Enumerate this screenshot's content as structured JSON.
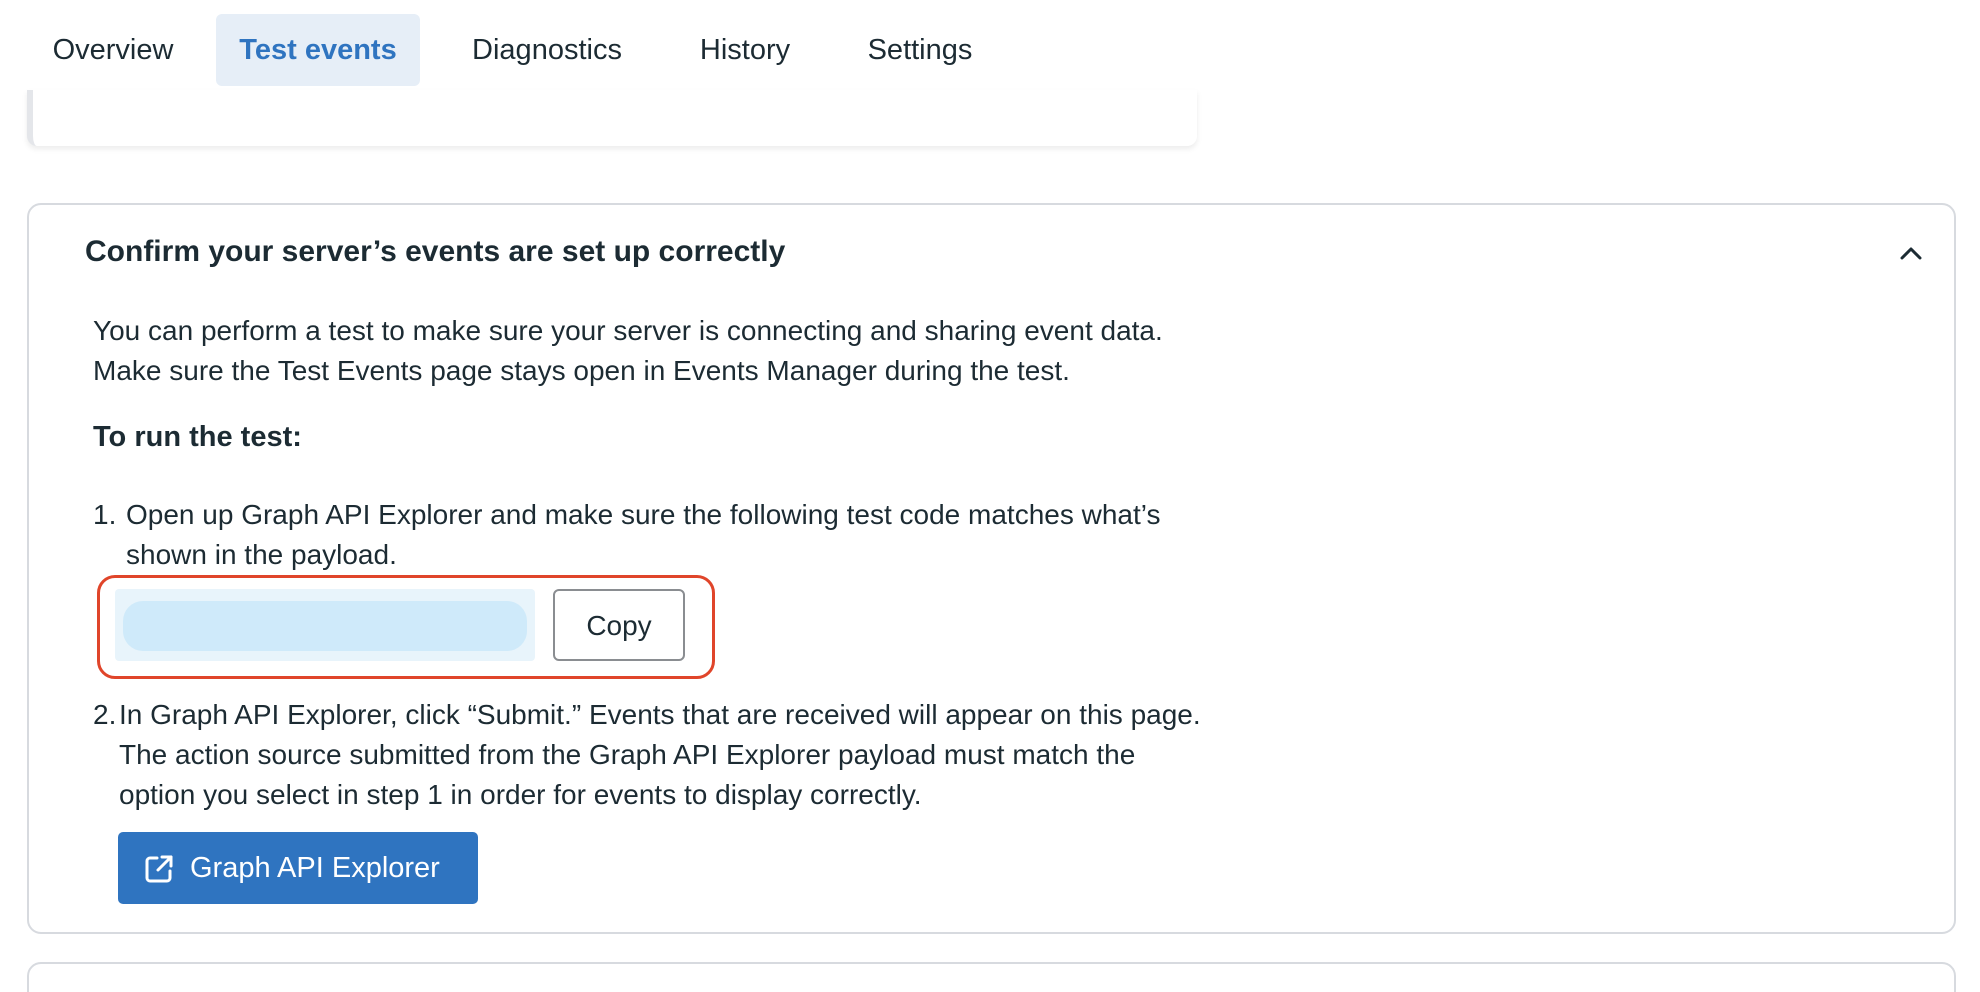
{
  "tabs": [
    {
      "label": "Overview",
      "active": false
    },
    {
      "label": "Test events",
      "active": true
    },
    {
      "label": "Diagnostics",
      "active": false
    },
    {
      "label": "History",
      "active": false
    },
    {
      "label": "Settings",
      "active": false
    }
  ],
  "card": {
    "title": "Confirm your server’s events are set up correctly",
    "description": [
      "You can perform a test to make sure your server is connecting and sharing event data.",
      "Make sure the Test Events page stays open in Events Manager during the test."
    ],
    "run_title": "To run the test:",
    "step1": {
      "number": "1.",
      "lines": [
        "Open up Graph API Explorer and make sure the following test code matches what’s",
        "shown in the payload."
      ],
      "test_code": "",
      "copy_label": "Copy"
    },
    "step2": {
      "number": "2.",
      "lines": [
        "In Graph API Explorer, click “Submit.” Events that are received will appear on this page.",
        "The action source submitted from the Graph API Explorer payload must match the",
        "option you select in step 1 in order for events to display correctly."
      ],
      "button_label": "Graph API Explorer",
      "button_icon": "external-link-icon"
    }
  },
  "colors": {
    "accent": "#2f74c0",
    "active_tab_bg": "#e6eef7",
    "highlight": "#e0452a",
    "code_bg": "#cfeafa"
  }
}
